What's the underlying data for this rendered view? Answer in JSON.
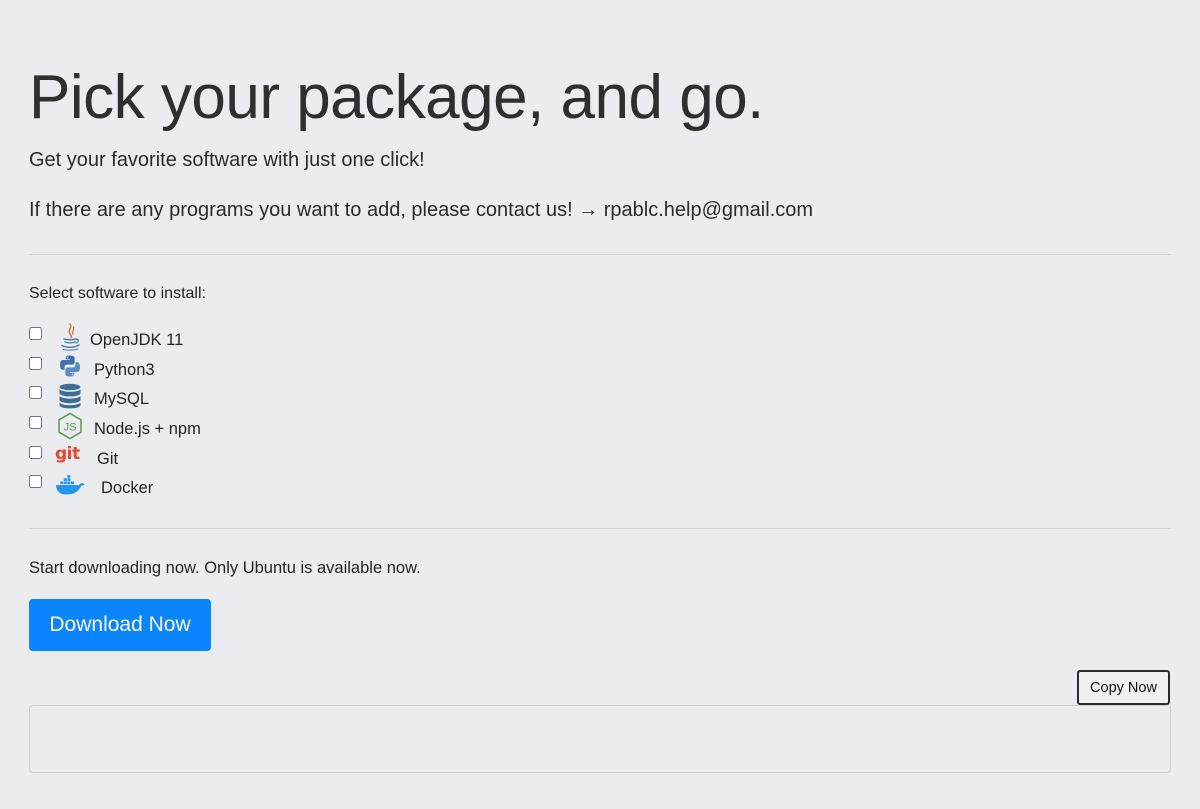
{
  "header": {
    "title": "Pick your package, and go.",
    "subtitle": "Get your favorite software with just one click!",
    "contact_line": "If there are any programs you want to add, please contact us! → rpablc.help@gmail.com"
  },
  "software": {
    "label": "Select software to install:",
    "items": [
      {
        "label": "OpenJDK 11",
        "icon": "java-icon",
        "checked": false
      },
      {
        "label": "Python3",
        "icon": "python-icon",
        "checked": false
      },
      {
        "label": "MySQL",
        "icon": "database-icon",
        "checked": false
      },
      {
        "label": "Node.js + npm",
        "icon": "nodejs-icon",
        "checked": false
      },
      {
        "label": "Git",
        "icon": "git-icon",
        "checked": false
      },
      {
        "label": "Docker",
        "icon": "docker-icon",
        "checked": false
      }
    ]
  },
  "download": {
    "text": "Start downloading now. Only Ubuntu is available now.",
    "button_label": "Download Now"
  },
  "output": {
    "copy_label": "Copy Now",
    "value": ""
  },
  "colors": {
    "background": "#ebecf0",
    "primary": "#0a84ff",
    "git": "#e8462f",
    "python_blue": "#3f72a8",
    "python_yellow": "#f4c93d",
    "mysql": "#3e6e93",
    "node": "#5c9a4c",
    "docker": "#2496ed",
    "java_blue": "#4b7ca5",
    "java_red": "#e06f2c"
  }
}
